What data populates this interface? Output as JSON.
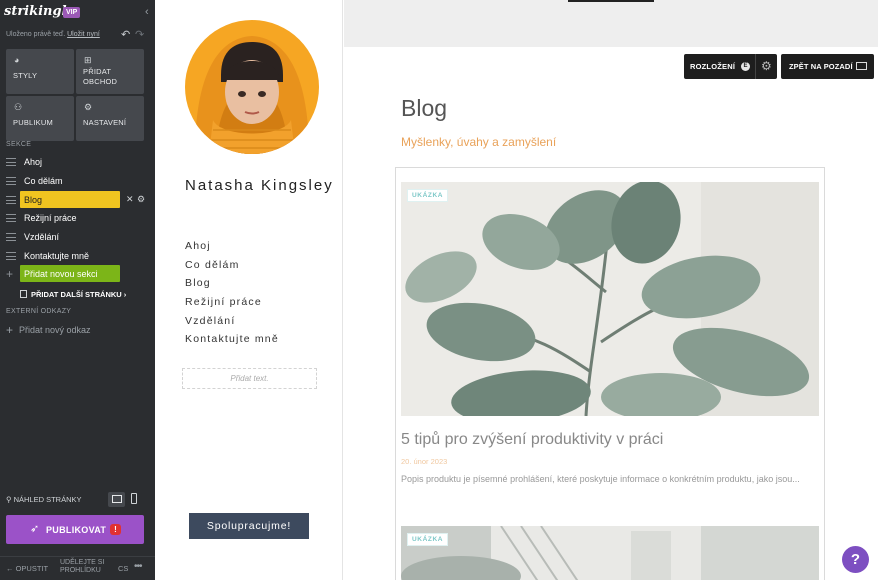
{
  "editor": {
    "logo": "strikingly",
    "vip_badge": "VIP",
    "save_status": "Uloženo právě teď.",
    "save_now": "Uložit nyní",
    "tiles": {
      "styles": "STYLY",
      "add_store": "PŘIDAT OBCHOD",
      "audience": "PUBLIKUM",
      "settings": "NASTAVENÍ"
    },
    "sections_header": "SEKCE",
    "sections": [
      {
        "label": "Ahoj"
      },
      {
        "label": "Co dělám"
      },
      {
        "label": "Blog"
      },
      {
        "label": "Režijní práce"
      },
      {
        "label": "Vzdělání"
      },
      {
        "label": "Kontaktujte mně"
      }
    ],
    "active_section": "Blog",
    "add_section": "Přidat novou sekci",
    "add_page": "PŘIDAT DALŠÍ STRÁNKU",
    "external_links_header": "EXTERNÍ ODKAZY",
    "add_link": "Přidat nový odkaz",
    "preview_label": "NÁHLED STRÁNKY",
    "publish_label": "PUBLIKOVAT",
    "publish_badge": "!",
    "exit_label": "OPUSTIT",
    "share_preview": "UDĚLEJTE SI PROHLÍDKU",
    "language": "CS",
    "colors": {
      "sidebar_bg": "#2b2d30",
      "active_section": "#f0c420",
      "add_section": "#7cb518",
      "publish": "#9b52c8"
    }
  },
  "site": {
    "name": "Natasha Kingsley",
    "nav": [
      "Ahoj",
      "Co dělám",
      "Blog",
      "Režijní práce",
      "Vzdělání",
      "Kontaktujte mně"
    ],
    "add_text_placeholder": "Přidat text.",
    "cta": "Spolupracujme!",
    "toolbar": {
      "layout": "ROZLOŽENÍ",
      "layout_badge": "E",
      "back_to_bg": "ZPĚT NA POZADÍ"
    },
    "blog": {
      "title": "Blog",
      "subtitle": "Myšlenky, úvahy a zamyšlení",
      "posts": [
        {
          "tag": "UKÁZKA",
          "title": "5 tipů pro zvýšení produktivity v práci",
          "date": "20. únor 2023",
          "excerpt": "Popis produktu je písemné prohlášení, které poskytuje informace o konkrétním produktu, jako jsou..."
        },
        {
          "tag": "UKÁZKA"
        }
      ]
    },
    "accent_color": "#e9a259"
  },
  "help_label": "?"
}
